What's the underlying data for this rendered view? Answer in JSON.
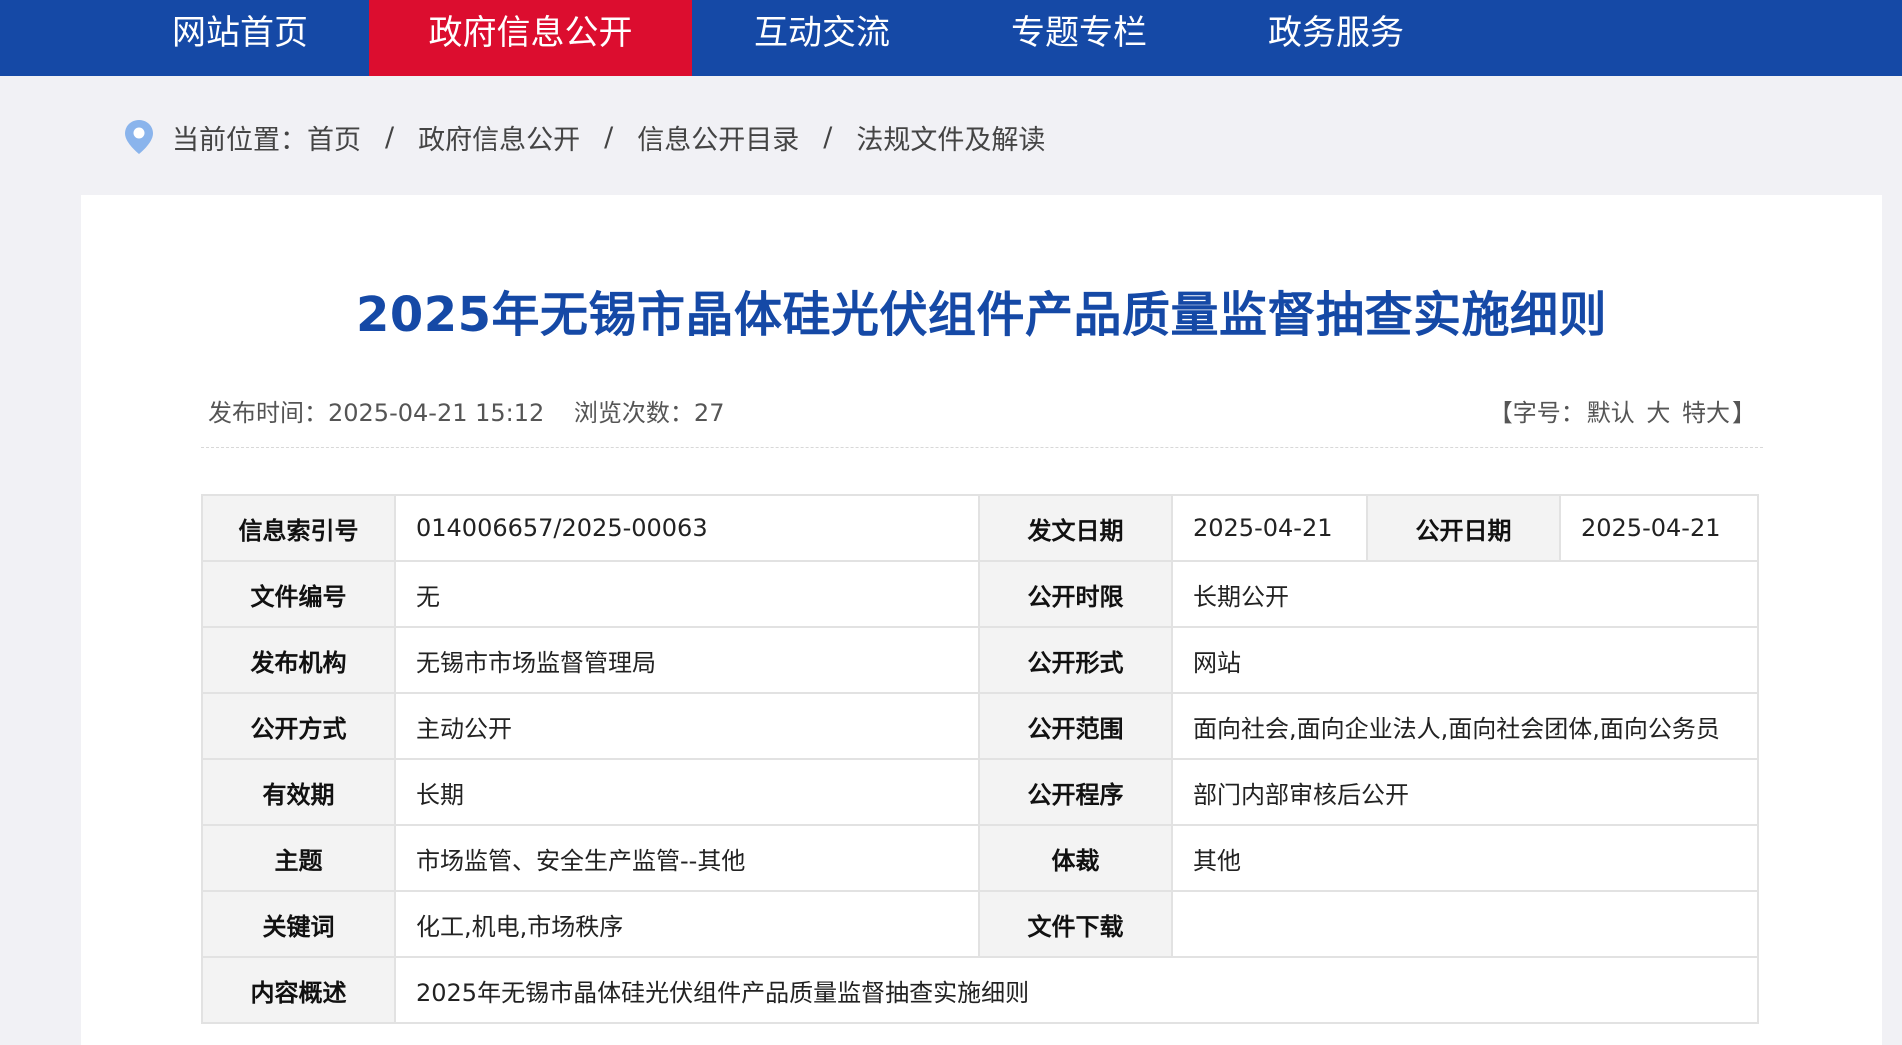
{
  "nav": {
    "items": [
      {
        "label": "网站首页",
        "active": false
      },
      {
        "label": "政府信息公开",
        "active": true
      },
      {
        "label": "互动交流",
        "active": false
      },
      {
        "label": "专题专栏",
        "active": false
      },
      {
        "label": "政务服务",
        "active": false
      }
    ]
  },
  "colors": {
    "nav_bg": "#1549a6",
    "nav_active": "#dc0d2f",
    "title": "#1549a6",
    "pin": "#8ab4ec"
  },
  "breadcrumb": {
    "prefix": "当前位置：",
    "items": [
      "首页",
      "政府信息公开",
      "信息公开目录",
      "法规文件及解读"
    ],
    "separator": "/"
  },
  "article": {
    "title": "2025年无锡市晶体硅光伏组件产品质量监督抽查实施细则",
    "publish_time_label": "发布时间：",
    "publish_time": "2025-04-21 15:12",
    "views_label": "浏览次数：",
    "views": "27",
    "fontsize_open": "【字号：",
    "fontsize_default": "默认",
    "fontsize_large": "大",
    "fontsize_xlarge": "特大",
    "fontsize_close": "】"
  },
  "info": {
    "index_no_label": "信息索引号",
    "index_no": "014006657/2025-00063",
    "issue_date_label": "发文日期",
    "issue_date": "2025-04-21",
    "public_date_label": "公开日期",
    "public_date": "2025-04-21",
    "doc_no_label": "文件编号",
    "doc_no": "无",
    "public_period_label": "公开时限",
    "public_period": "长期公开",
    "issuer_label": "发布机构",
    "issuer": "无锡市市场监督管理局",
    "public_form_label": "公开形式",
    "public_form": "网站",
    "public_method_label": "公开方式",
    "public_method": "主动公开",
    "public_scope_label": "公开范围",
    "public_scope": "面向社会,面向企业法人,面向社会团体,面向公务员",
    "validity_label": "有效期",
    "validity": "长期",
    "public_procedure_label": "公开程序",
    "public_procedure": "部门内部审核后公开",
    "subject_label": "主题",
    "subject": "市场监管、安全生产监管--其他",
    "genre_label": "体裁",
    "genre": "其他",
    "keywords_label": "关键词",
    "keywords": "化工,机电,市场秩序",
    "download_label": "文件下载",
    "download": "",
    "summary_label": "内容概述",
    "summary": "2025年无锡市晶体硅光伏组件产品质量监督抽查实施细则"
  }
}
